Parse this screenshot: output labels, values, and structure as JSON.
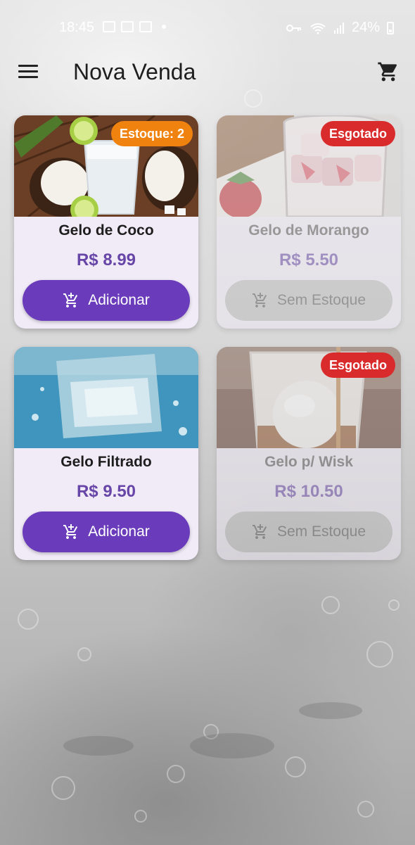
{
  "status_bar": {
    "time": "18:45",
    "battery": "24%"
  },
  "app_bar": {
    "title": "Nova Venda"
  },
  "products": [
    {
      "name": "Gelo de Coco",
      "price": "R$ 8.99",
      "button": "Adicionar",
      "badge": "Estoque: 2",
      "badge_color": "#f0820f",
      "available": true
    },
    {
      "name": "Gelo de Morango",
      "price": "R$ 5.50",
      "button": "Sem Estoque",
      "badge": "Esgotado",
      "badge_color": "#d92b2b",
      "available": false
    },
    {
      "name": "Gelo Filtrado",
      "price": "R$ 9.50",
      "button": "Adicionar",
      "badge": "",
      "available": true
    },
    {
      "name": "Gelo p/ Wisk",
      "price": "R$ 10.50",
      "button": "Sem Estoque",
      "badge": "Esgotado",
      "badge_color": "#d92b2b",
      "available": false
    }
  ],
  "colors": {
    "primary": "#6a3bbb",
    "price": "#6746a8",
    "card": "#f1ebf8"
  }
}
